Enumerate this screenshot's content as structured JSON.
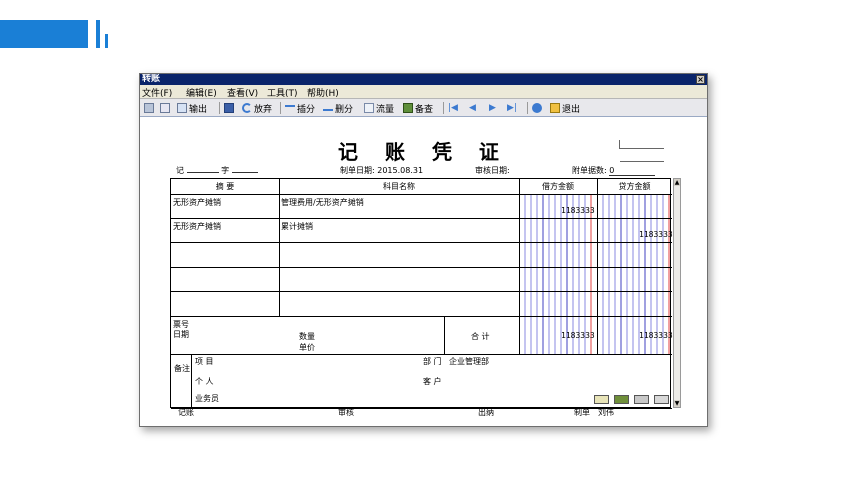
{
  "window": {
    "title": "转账",
    "close_symbol": "×"
  },
  "menu": [
    "文件(F)",
    "编辑(E)",
    "查看(V)",
    "工具(T)",
    "帮助(H)"
  ],
  "toolbar": {
    "output": "输出",
    "abandon": "放弃",
    "insert": "插分",
    "delete": "删分",
    "flow": "流量",
    "check": "备查",
    "exit": "退出"
  },
  "voucher": {
    "title": "记 账 凭 证",
    "type_label": "记",
    "number_label": "字",
    "date_label": "制单日期:",
    "date_value": "2015.08.31",
    "audit_date_label": "审核日期:",
    "attachments_label": "附单据数:",
    "attachments_value": "0"
  },
  "table": {
    "headers": {
      "summary": "摘 要",
      "account": "科目名称",
      "debit": "借方金额",
      "credit": "贷方金额"
    },
    "rows": [
      {
        "summary": "无形资产摊销",
        "account": "管理费用/无形资产摊销",
        "debit": "1183333",
        "credit": ""
      },
      {
        "summary": "无形资产摊销",
        "account": "累计摊销",
        "debit": "",
        "credit": "1183333"
      },
      {
        "summary": "",
        "account": "",
        "debit": "",
        "credit": ""
      },
      {
        "summary": "",
        "account": "",
        "debit": "",
        "credit": ""
      },
      {
        "summary": "",
        "account": "",
        "debit": "",
        "credit": ""
      }
    ],
    "ticket_label": "票号",
    "date_label": "日期",
    "quantity_label": "数量",
    "price_label": "单价",
    "total_label": "合 计",
    "total_debit": "1183333",
    "total_credit": "1183333",
    "notes_label": "备注",
    "project_label": "项 目",
    "department_label": "部 门",
    "department_value": "企业管理部",
    "person_label": "个 人",
    "customer_label": "客 户",
    "salesperson_label": "业务员"
  },
  "footer": {
    "bookkeeper": "记账",
    "auditor": "审核",
    "cashier": "出纳",
    "maker": "制单",
    "maker_name": "刘伟"
  }
}
